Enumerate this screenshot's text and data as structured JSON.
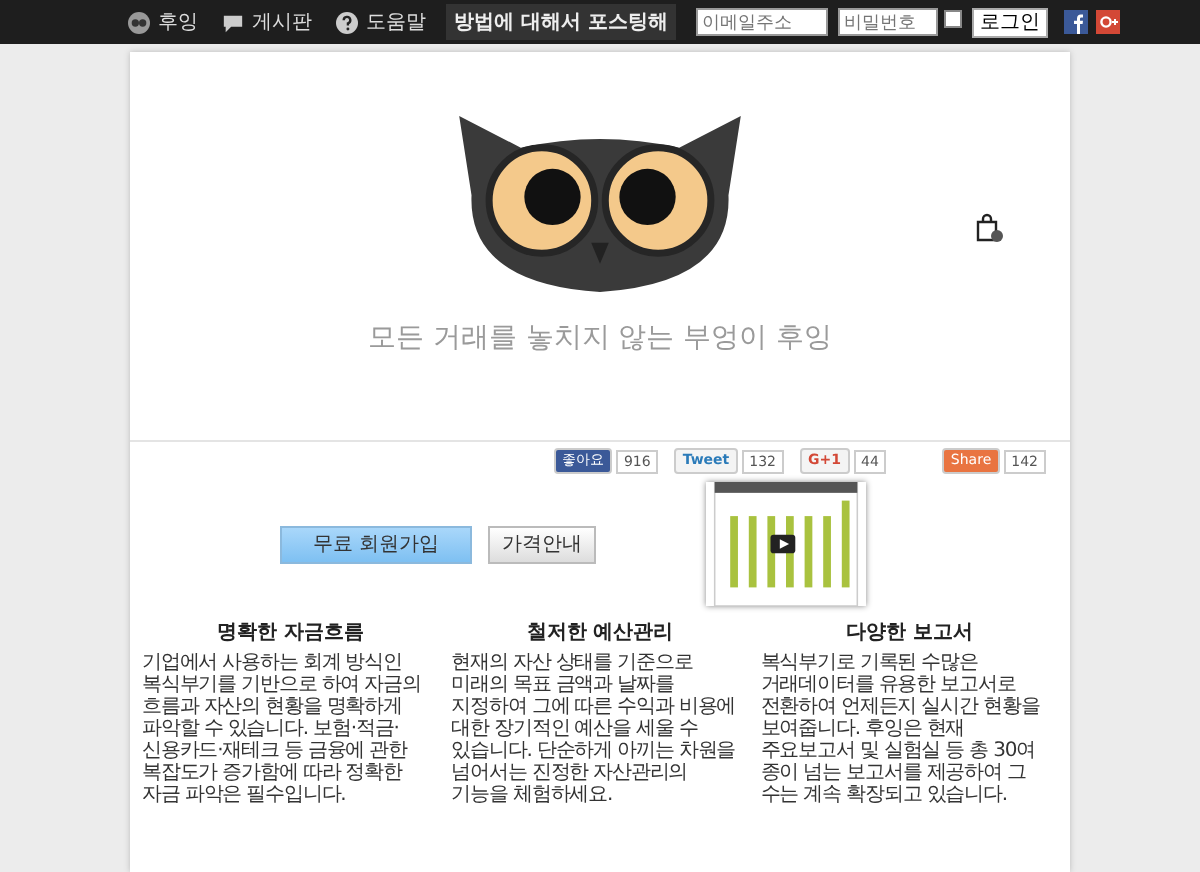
{
  "nav": {
    "items": [
      {
        "label": "후잉",
        "kind": "home"
      },
      {
        "label": "게시판",
        "kind": "board"
      },
      {
        "label": "도움말",
        "kind": "help"
      }
    ],
    "ticker": "방법에 대해서 포스팅해",
    "email": {
      "placeholder": "이메일주소"
    },
    "password": {
      "placeholder": "비밀번호"
    },
    "remember": {
      "checked": false
    },
    "login": "로그인"
  },
  "hero": {
    "tagline": "모든 거래를 놓치지 않는 부엉이 후잉"
  },
  "share": [
    {
      "label": "좋아요",
      "count": "916",
      "kind": "facebook"
    },
    {
      "label": "Tweet",
      "count": "132",
      "kind": "twitter"
    },
    {
      "label": "G+1",
      "count": "44",
      "kind": "gplus"
    },
    {
      "label": "Share",
      "count": "142",
      "kind": "share"
    }
  ],
  "actions": {
    "signup": "무료 회원가입",
    "pricing": "가격안내"
  },
  "features": [
    {
      "title": "명확한 자금흐름",
      "text": "기업에서 사용하는 회계 방식인 복식부기를 기반으로 하여 자금의 흐름과 자산의 현황을 명확하게 파악할 수 있습니다. 보험·적금·신용카드·재테크 등 금융에 관한 복잡도가 증가함에 따라 정확한 자금 파악은 필수입니다."
    },
    {
      "title": "철저한 예산관리",
      "text": "현재의 자산 상태를 기준으로 미래의 목표 금액과 날짜를 지정하여 그에 따른 수익과 비용에 대한 장기적인 예산을 세울 수 있습니다. 단순하게 아끼는 차원을 넘어서는 진정한 자산관리의 기능을 체험하세요."
    },
    {
      "title": "다양한 보고서",
      "text": "복식부기로 기록된 수많은 거래데이터를 유용한 보고서로 전환하여 언제든지 실시간 현황을 보여줍니다. 후잉은 현재 주요보고서 및 실험실 등 총 30여 종이 넘는 보고서를 제공하여 그 수는 계속 확장되고 있습니다."
    }
  ]
}
